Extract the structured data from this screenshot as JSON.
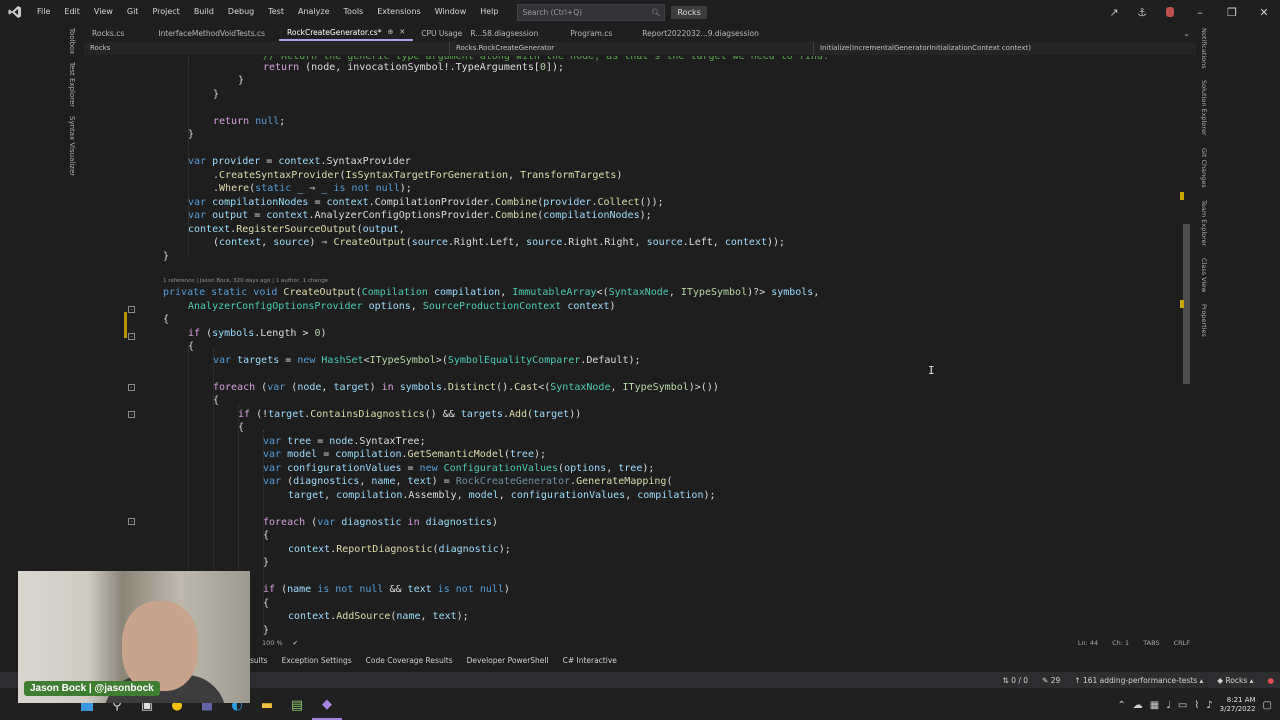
{
  "menu": [
    "File",
    "Edit",
    "View",
    "Git",
    "Project",
    "Build",
    "Debug",
    "Test",
    "Analyze",
    "Tools",
    "Extensions",
    "Window",
    "Help"
  ],
  "search": {
    "placeholder": "Search (Ctrl+Q)"
  },
  "solution": "Rocks",
  "left_tool_tabs": [
    "Toolbox",
    "Test Explorer",
    "Syntax Visualizer"
  ],
  "right_tool_tabs": [
    "Notifications",
    "Solution Explorer",
    "Git Changes",
    "Team Explorer",
    "Class View",
    "Properties"
  ],
  "doc_tabs": [
    {
      "label": "Rocks.cs"
    },
    {
      "label": "InterfaceMethodVoidTests.cs"
    },
    {
      "label": "RockCreateGenerator.cs*",
      "pin": "⊕",
      "close": "✕"
    },
    {
      "label": "CPU Usage"
    },
    {
      "label": "R...58.diagsession"
    },
    {
      "label": "Program.cs"
    },
    {
      "label": "Report2022032...9.diagsession"
    }
  ],
  "navbar": {
    "project": "Rocks",
    "type": "Rocks.RockCreateGenerator",
    "member": "Initialize(IncrementalGeneratorInitializationContext context)"
  },
  "codelens": "1 reference | Jason Bock, 320 days ago | 1 author, 1 change",
  "editor_footer": {
    "zoom": "100 %",
    "line": "Ln: 44",
    "col": "Ch: 1",
    "tabs": "TABS",
    "eol": "CRLF"
  },
  "tool_tabs": [
    "sults",
    "Exception Settings",
    "Code Coverage Results",
    "Developer PowerShell",
    "C# Interactive"
  ],
  "status": {
    "errors": "0 / 0",
    "edits": "29",
    "changes": "161",
    "branch": "adding-performance-tests",
    "repo": "Rocks"
  },
  "clock": {
    "time": "8:21 AM",
    "date": "3/27/2022"
  },
  "webcam_name": "Jason Bock | @jasonbock",
  "colors": {
    "accent": "#b4a0e6",
    "keyword": "#569cd6",
    "type": "#4ec9b0",
    "method": "#dcdcaa"
  }
}
